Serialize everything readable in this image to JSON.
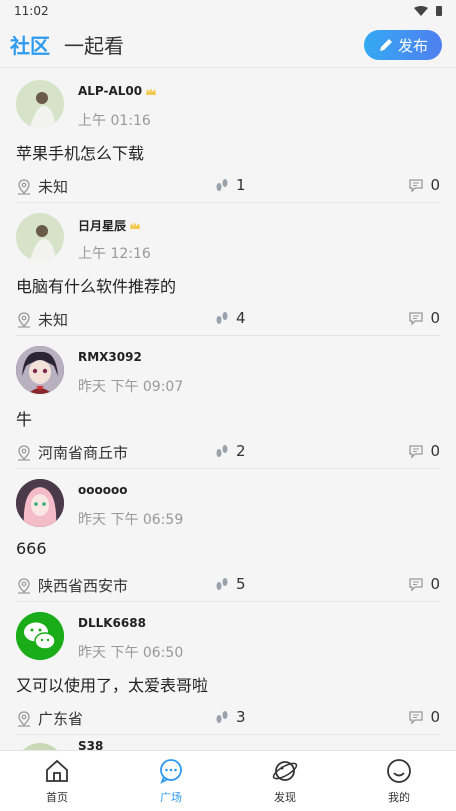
{
  "status": {
    "time": "11:02"
  },
  "header": {
    "tab_active": "社区",
    "tab_inactive": "一起看",
    "publish_label": "发布"
  },
  "posts": [
    {
      "username": "ALP-AL00",
      "vip": true,
      "time": "上午 01:16",
      "content": "苹果手机怎么下载",
      "location": "未知",
      "steps": "1",
      "comments": "0",
      "avatar": "landscape"
    },
    {
      "username": "日月星辰",
      "vip": true,
      "time": "上午 12:16",
      "content": "电脑有什么软件推荐的",
      "location": "未知",
      "steps": "4",
      "comments": "0",
      "avatar": "landscape"
    },
    {
      "username": "RMX3092",
      "vip": false,
      "time": "昨天 下午 09:07",
      "content": "牛",
      "location": "河南省商丘市",
      "steps": "2",
      "comments": "0",
      "avatar": "anime"
    },
    {
      "username": "oooooo",
      "vip": false,
      "time": "昨天 下午 06:59",
      "content": "666",
      "location": "陕西省西安市",
      "steps": "5",
      "comments": "0",
      "avatar": "pink"
    },
    {
      "username": "DLLK6688",
      "vip": false,
      "time": "昨天 下午 06:50",
      "content": "又可以使用了，太爱表哥啦",
      "location": "广东省",
      "steps": "3",
      "comments": "0",
      "avatar": "wechat"
    }
  ],
  "partial_post": {
    "username": "S38"
  },
  "nav": [
    {
      "label": "首页",
      "icon": "home-icon"
    },
    {
      "label": "广场",
      "icon": "chat-icon"
    },
    {
      "label": "发现",
      "icon": "planet-icon"
    },
    {
      "label": "我的",
      "icon": "smile-icon"
    }
  ],
  "colors": {
    "accent": "#2e9af0",
    "vip": "#f2c94c"
  }
}
